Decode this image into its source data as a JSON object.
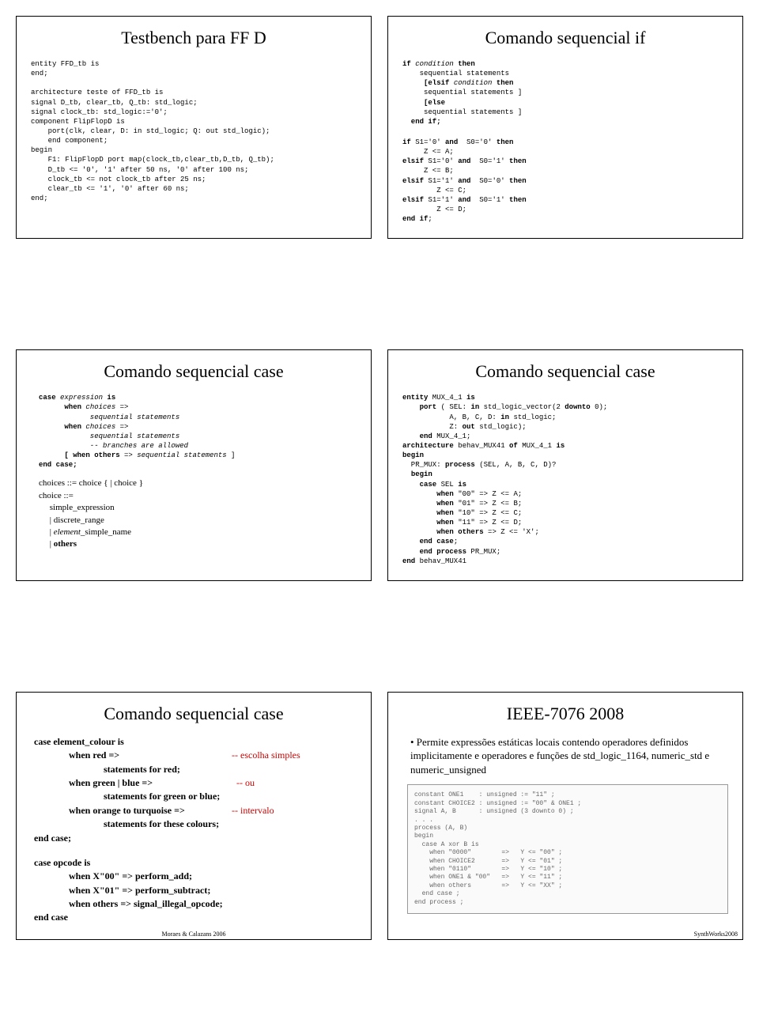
{
  "slides": {
    "s1": {
      "title": "Testbench para FF D",
      "code": "entity FFD_tb is\nend;\n\narchitecture teste of FFD_tb is\nsignal D_tb, clear_tb, Q_tb: std_logic;\nsignal clock_tb: std_logic:='0';\ncomponent FlipFlopD is\n    port(clk, clear, D: in std_logic; Q: out std_logic);\n    end component;\nbegin\n    F1: FlipFlopD port map(clock_tb,clear_tb,D_tb, Q_tb);\n    D_tb <= '0', '1' after 50 ns, '0' after 100 ns;\n    clock_tb <= not clock_tb after 25 ns;\n    clear_tb <= '1', '0' after 60 ns;\nend;"
    },
    "s2": {
      "title": "Comando sequencial if",
      "syntax_lines": [
        {
          "t": "if ",
          "kw": true
        },
        {
          "t": "condition",
          "it": true
        },
        {
          "t": " then",
          "kw": true
        },
        {
          "br": true
        },
        {
          "t": "    sequential statements"
        },
        {
          "br": true
        },
        {
          "t": "     [elsif ",
          "kw": true
        },
        {
          "t": "condition",
          "it": true
        },
        {
          "t": " then",
          "kw": true
        },
        {
          "br": true
        },
        {
          "t": "     sequential statements ]"
        },
        {
          "br": true
        },
        {
          "t": "     [else",
          "kw": true
        },
        {
          "br": true
        },
        {
          "t": "     sequential statements ]"
        },
        {
          "br": true
        },
        {
          "t": "  end if;",
          "kw": true
        }
      ],
      "example": "if S1='0' and  S0='0' then\n     Z <= A;\nelsif S1='0' and  S0='1' then\n     Z <= B;\nelsif S1='1' and  S0='0' then\n        Z <= C;\nelsif S1='1' and  S0='1' then\n        Z <= D;\nend if;"
    },
    "s3": {
      "title": "Comando sequencial case",
      "syntax_lines": [
        {
          "t": "case ",
          "kw": true
        },
        {
          "t": "expression",
          "it": true
        },
        {
          "t": " is",
          "kw": true
        },
        {
          "br": true
        },
        {
          "t": "      when ",
          "kw": true
        },
        {
          "t": "choices",
          "it": true
        },
        {
          "t": " =>"
        },
        {
          "br": true
        },
        {
          "t": "            sequential statements",
          "it": true
        },
        {
          "br": true
        },
        {
          "t": "      when ",
          "kw": true
        },
        {
          "t": "choices",
          "it": true
        },
        {
          "t": " =>"
        },
        {
          "br": true
        },
        {
          "t": "            sequential statements",
          "it": true
        },
        {
          "br": true
        },
        {
          "t": "            -- branches are allowed",
          "it": true
        },
        {
          "br": true
        },
        {
          "t": "      [ when others ",
          "kw": true
        },
        {
          "t": "=> sequential statements",
          "it": true
        },
        {
          "t": " ]"
        },
        {
          "br": true
        },
        {
          "t": "end case;",
          "kw": true
        }
      ],
      "grammar": "choices ::= choice { | choice }\nchoice ::=\n     simple_expression\n     | discrete_range\n     | element_simple_name\n     | others",
      "grammar_italic_word": "element"
    },
    "s4": {
      "title": "Comando sequencial case",
      "code": "entity MUX_4_1 is\n    port ( SEL: in std_logic_vector(2 downto 0);\n           A, B, C, D: in std_logic;\n           Z: out std_logic);\n    end MUX_4_1;\narchitecture behav_MUX41 of MUX_4_1 is\nbegin\n  PR_MUX: process (SEL, A, B, C, D)?\n  begin\n    case SEL is\n        when \"00\" => Z <= A;\n        when \"01\" => Z <= B;\n        when \"10\" => Z <= C;\n        when \"11\" => Z <= D;\n        when others => Z <= 'X';\n    end case;\n    end process PR_MUX;\nend behav_MUX41"
    },
    "s5": {
      "title": "Comando sequencial case",
      "block1": {
        "l1": "case element_colour is",
        "l2": "when red =>",
        "c2": "-- escolha simples",
        "l3": "statements for red;",
        "l4": "when green | blue =>",
        "c4": "-- ou",
        "l5": "statements for green or blue;",
        "l6": "when orange to turquoise =>",
        "c6": "-- intervalo",
        "l7": "statements for these colours;",
        "l8": "end case;"
      },
      "block2": {
        "l1": "case opcode is",
        "l2": "when X\"00\" => perform_add;",
        "l3": "when X\"01\" => perform_subtract;",
        "l4": "when others => signal_illegal_opcode;",
        "l5": "end case"
      },
      "footer": "Moraes & Calazans 2006"
    },
    "s6": {
      "title": "IEEE-7076 2008",
      "bullet": "• Permite expressões estáticas locais contendo operadores definidos implicitamente e operadores e funções de std_logic_1164, numeric_std e numeric_unsigned",
      "snippet": "constant ONE1    : unsigned := \"11\" ;\nconstant CHOICE2 : unsigned := \"00\" & ONE1 ;\nsignal A, B      : unsigned (3 downto 0) ;\n. . .\nprocess (A, B)\nbegin\n  case A xor B is\n    when \"0000\"        =>   Y <= \"00\" ;\n    when CHOICE2       =>   Y <= \"01\" ;\n    when \"0110\"        =>   Y <= \"10\" ;\n    when ONE1 & \"00\"   =>   Y <= \"11\" ;\n    when others        =>   Y <= \"XX\" ;\n  end case ;\nend process ;",
      "footer": "SynthWorks2008"
    }
  }
}
